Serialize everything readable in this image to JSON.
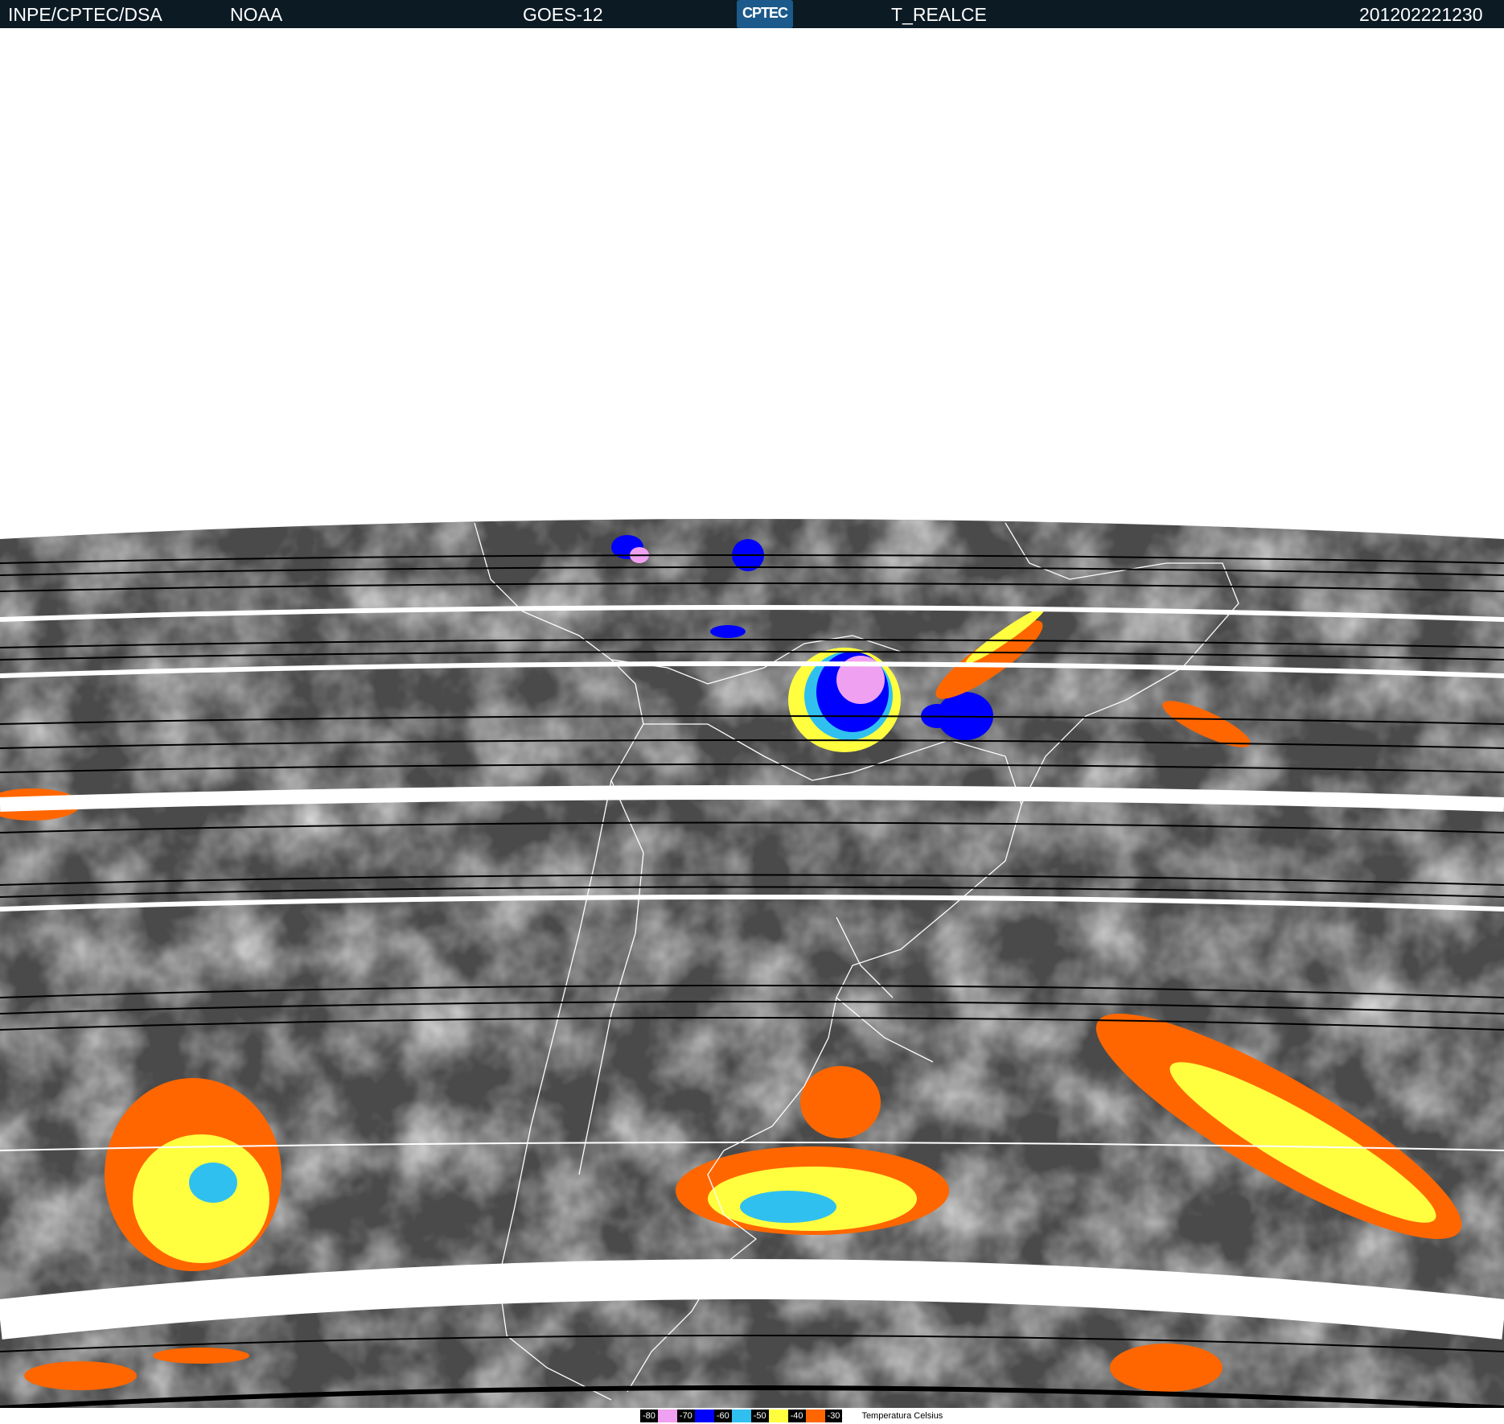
{
  "header": {
    "org": "INPE/CPTEC/DSA",
    "agency": "NOAA",
    "satellite": "GOES-12",
    "logo_text": "CPTEC",
    "product": "T_REALCE",
    "timestamp": "201202221230"
  },
  "legend": {
    "items": [
      {
        "label": "-80",
        "color": "#f0a0f0"
      },
      {
        "label": "-70",
        "color": "#0000ff"
      },
      {
        "label": "-60",
        "color": "#30c0f0"
      },
      {
        "label": "-50",
        "color": "#ffff40"
      },
      {
        "label": "-40",
        "color": "#ff6600"
      },
      {
        "label": "-30",
        "color": ""
      }
    ],
    "title": "Temperatura  Celsius"
  },
  "colors": {
    "background_gray": "#4a4a4a",
    "cloud_light": "#bdbdbd",
    "border_lines": "#ffffff",
    "scanline_black": "#000000"
  }
}
